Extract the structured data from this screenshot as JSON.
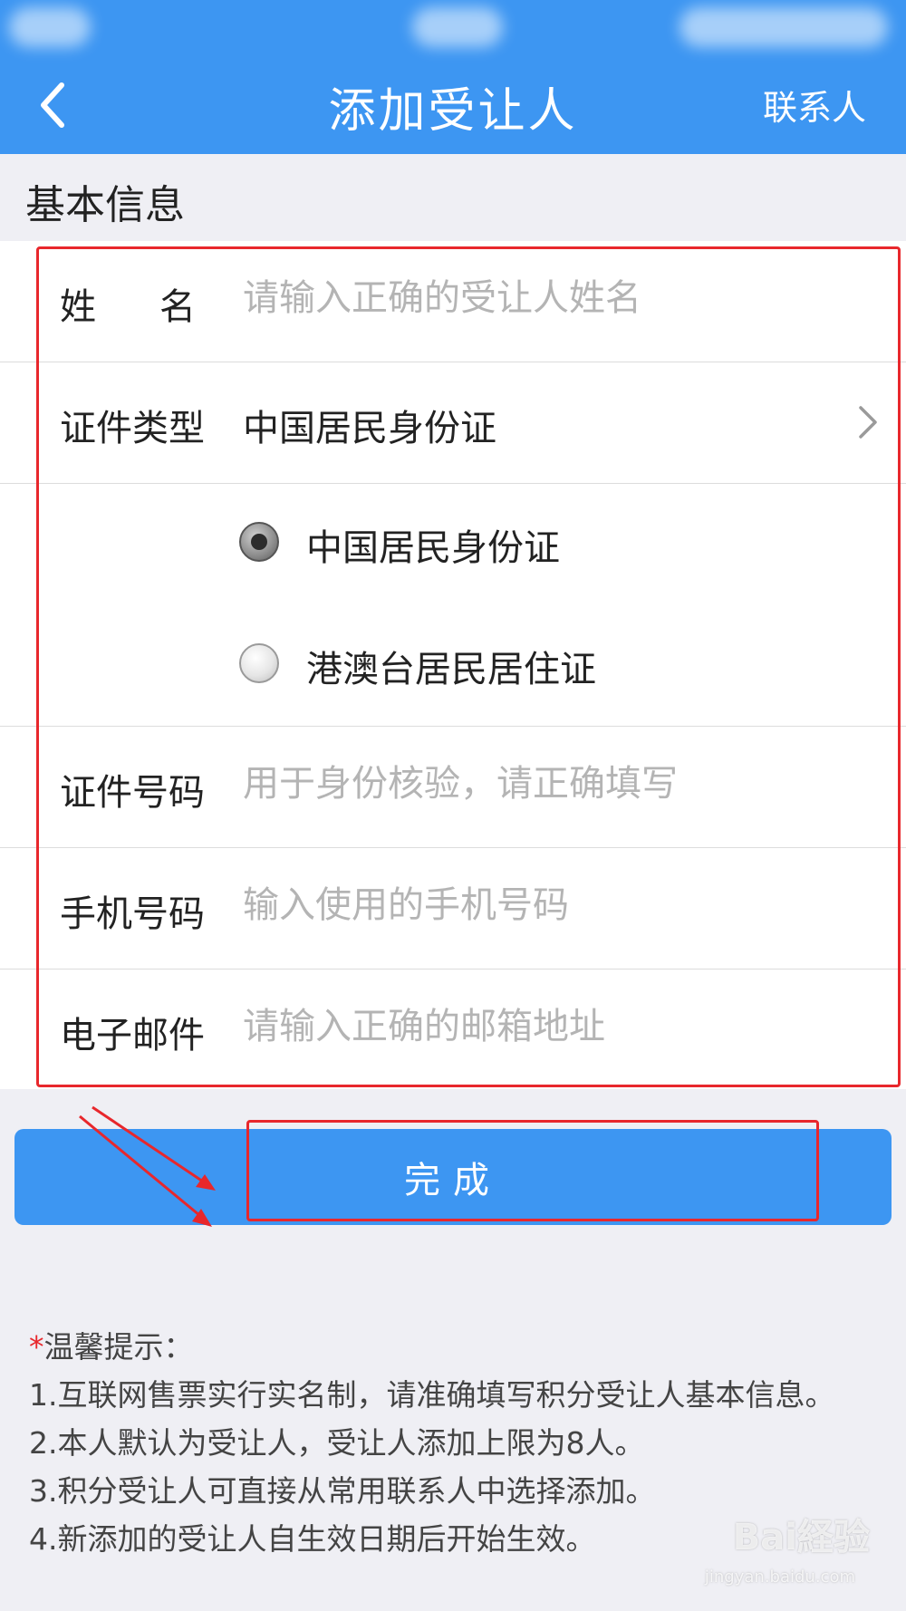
{
  "header": {
    "title": "添加受让人",
    "contacts_label": "联系人",
    "background": "#3d96f2"
  },
  "section": {
    "title": "基本信息"
  },
  "form": {
    "name": {
      "label": "姓名",
      "placeholder": "请输入正确的受让人姓名"
    },
    "id_type": {
      "label": "证件类型",
      "value": "中国居民身份证"
    },
    "id_options": [
      {
        "label": "中国居民身份证",
        "checked": true
      },
      {
        "label": "港澳台居民居住证",
        "checked": false
      }
    ],
    "id_number": {
      "label": "证件号码",
      "placeholder": "用于身份核验，请正确填写"
    },
    "phone": {
      "label": "手机号码",
      "placeholder": "输入使用的手机号码"
    },
    "email": {
      "label": "电子邮件",
      "placeholder": "请输入正确的邮箱地址"
    }
  },
  "done_button": {
    "label": "完成"
  },
  "tips": {
    "title": "温馨提示：",
    "star": "*",
    "items": [
      "1.互联网售票实行实名制，请准确填写积分受让人基本信息。",
      "2.本人默认为受让人，受让人添加上限为8人。",
      "3.积分受让人可直接从常用联系人中选择添加。",
      "4.新添加的受让人自生效日期后开始生效。"
    ]
  },
  "watermark": {
    "brand": "Bai経验",
    "url": "jingyan.baidu.com"
  },
  "colors": {
    "accent": "#3d96f2",
    "annotation": "#e8272c"
  }
}
